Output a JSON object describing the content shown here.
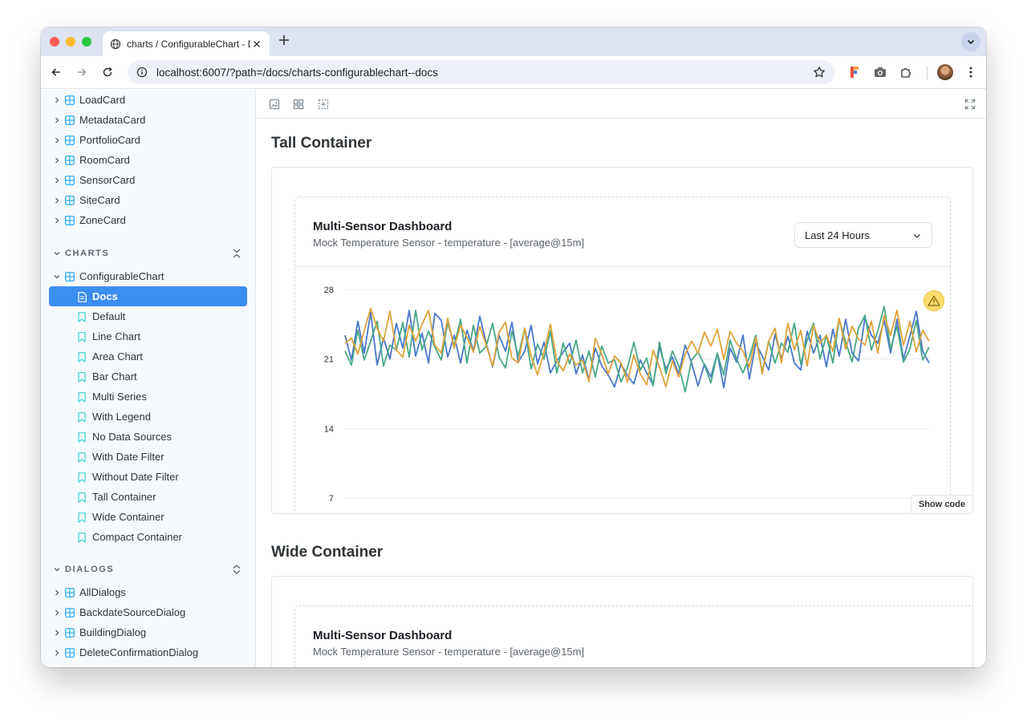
{
  "browser": {
    "tab_title": "charts / ConfigurableChart - D",
    "url": "localhost:6007/?path=/docs/charts-configurablechart--docs"
  },
  "sidebar": {
    "components_top": [
      "LoadCard",
      "MetadataCard",
      "PortfolioCard",
      "RoomCard",
      "SensorCard",
      "SiteCard",
      "ZoneCard"
    ],
    "charts_section": "CHARTS",
    "charts_component": "ConfigurableChart",
    "active_story": "Docs",
    "stories": [
      "Default",
      "Line Chart",
      "Area Chart",
      "Bar Chart",
      "Multi Series",
      "With Legend",
      "No Data Sources",
      "With Date Filter",
      "Without Date Filter",
      "Tall Container",
      "Wide Container",
      "Compact Container"
    ],
    "dialogs_section": "DIALOGS",
    "dialogs": [
      "AllDialogs",
      "BackdateSourceDialog",
      "BuildingDialog",
      "DeleteConfirmationDialog"
    ]
  },
  "main": {
    "tall_heading": "Tall Container",
    "wide_heading": "Wide Container",
    "show_code": "Show code",
    "card": {
      "title": "Multi-Sensor Dashboard",
      "subtitle": "Mock Temperature Sensor - temperature - [average@15m]",
      "range": "Last 24 Hours"
    }
  },
  "icons": {
    "toolbar": [
      "back-icon",
      "forward-icon",
      "reload-icon",
      "info-icon",
      "star-icon",
      "extension-icon",
      "camera-icon",
      "puzzle-icon",
      "menu-icon"
    ],
    "docbar": [
      "image-icon",
      "grid-icon",
      "outline-icon",
      "fullscreen-icon"
    ],
    "chart": "warning-icon"
  },
  "colors": {
    "accent": "#3b8ff0",
    "series_blue": "#4a78c9",
    "series_green": "#48a886",
    "series_orange": "#e0a33a",
    "warning": "#f9dc70"
  },
  "chart_data": {
    "type": "line",
    "title": "Multi-Sensor Dashboard",
    "subtitle": "Mock Temperature Sensor - temperature - [average@15m]",
    "yticks": [
      "28",
      "21",
      "14",
      "7"
    ],
    "ylim": [
      7,
      28
    ],
    "grid": true,
    "series": [
      {
        "color": "#4a78c9",
        "values": [
          23.4,
          20.9,
          24.8,
          21.6,
          25.7,
          20.4,
          23.1,
          21.0,
          24.6,
          22.1,
          25.9,
          21.3,
          23.6,
          20.6,
          25.6,
          24.9,
          21.2,
          23.4,
          20.6,
          23.9,
          21.8,
          25.3,
          22.6,
          20.2,
          23.4,
          21.8,
          24.7,
          20.7,
          21.8,
          24.4,
          20.5,
          22.7,
          19.6,
          20.8,
          21.7,
          22.6,
          19.5,
          21.4,
          18.9,
          22.1,
          20.3,
          19.4,
          18.2,
          20.5,
          19.3,
          18.5,
          20.9,
          19.6,
          18.4,
          22.2,
          20.0,
          21.2,
          19.5,
          22.4,
          20.6,
          18.3,
          20.5,
          19.2,
          21.6,
          18.1,
          22.1,
          20.7,
          23.4,
          19.0,
          22.6,
          21.3,
          19.9,
          23.5,
          21.0,
          23.3,
          20.6,
          19.9,
          23.8,
          21.6,
          23.4,
          20.2,
          24.0,
          21.3,
          25.0,
          21.6,
          20.8,
          25.1,
          23.4,
          22.6,
          24.9,
          21.6,
          25.0,
          21.0,
          23.3,
          25.8,
          21.8,
          20.6
        ],
        "name": ""
      },
      {
        "color": "#48a886",
        "values": [
          21.8,
          20.4,
          23.9,
          20.9,
          22.8,
          24.8,
          20.3,
          22.4,
          21.9,
          24.7,
          21.2,
          25.9,
          21.9,
          23.8,
          22.2,
          20.9,
          24.7,
          22.3,
          25.0,
          20.6,
          24.4,
          21.6,
          22.3,
          24.6,
          21.2,
          20.1,
          23.8,
          21.3,
          24.1,
          20.0,
          22.5,
          21.0,
          23.8,
          19.6,
          22.6,
          20.5,
          22.9,
          19.6,
          21.8,
          19.2,
          22.3,
          20.6,
          20.9,
          18.7,
          20.1,
          22.7,
          19.9,
          21.1,
          18.3,
          22.7,
          19.5,
          21.8,
          20.3,
          17.7,
          20.9,
          21.7,
          20.4,
          18.6,
          21.6,
          19.4,
          22.9,
          21.0,
          19.6,
          21.2,
          23.4,
          19.7,
          22.8,
          20.6,
          22.6,
          21.7,
          24.6,
          20.5,
          22.9,
          24.6,
          21.0,
          23.4,
          20.6,
          25.0,
          22.7,
          20.7,
          24.1,
          25.4,
          21.9,
          23.8,
          26.3,
          22.0,
          24.3,
          20.7,
          22.0,
          24.9,
          20.9,
          22.2
        ],
        "name": ""
      },
      {
        "color": "#e0a33a",
        "values": [
          22.6,
          23.1,
          21.5,
          23.9,
          26.1,
          24.1,
          22.8,
          25.8,
          21.9,
          21.2,
          24.4,
          22.8,
          24.5,
          25.9,
          22.4,
          21.6,
          25.1,
          22.1,
          24.4,
          23.2,
          21.7,
          24.3,
          22.4,
          20.3,
          23.7,
          24.7,
          21.1,
          20.6,
          24.1,
          21.3,
          19.4,
          21.7,
          24.5,
          20.8,
          19.8,
          21.5,
          20.4,
          20.9,
          18.7,
          23.1,
          21.5,
          19.5,
          21.3,
          20.6,
          18.7,
          21.4,
          19.5,
          18.4,
          21.9,
          20.2,
          18.2,
          20.8,
          19.2,
          21.5,
          22.8,
          21.6,
          23.7,
          22.3,
          24.0,
          21.0,
          23.8,
          22.6,
          21.8,
          20.2,
          23.2,
          19.5,
          22.8,
          24.1,
          20.6,
          24.6,
          21.9,
          23.9,
          20.3,
          24.4,
          22.6,
          23.4,
          21.8,
          25.1,
          22.0,
          24.3,
          23.0,
          22.4,
          24.8,
          21.6,
          25.4,
          23.4,
          25.9,
          22.4,
          24.8,
          21.7,
          23.9,
          22.8
        ],
        "name": ""
      }
    ]
  }
}
